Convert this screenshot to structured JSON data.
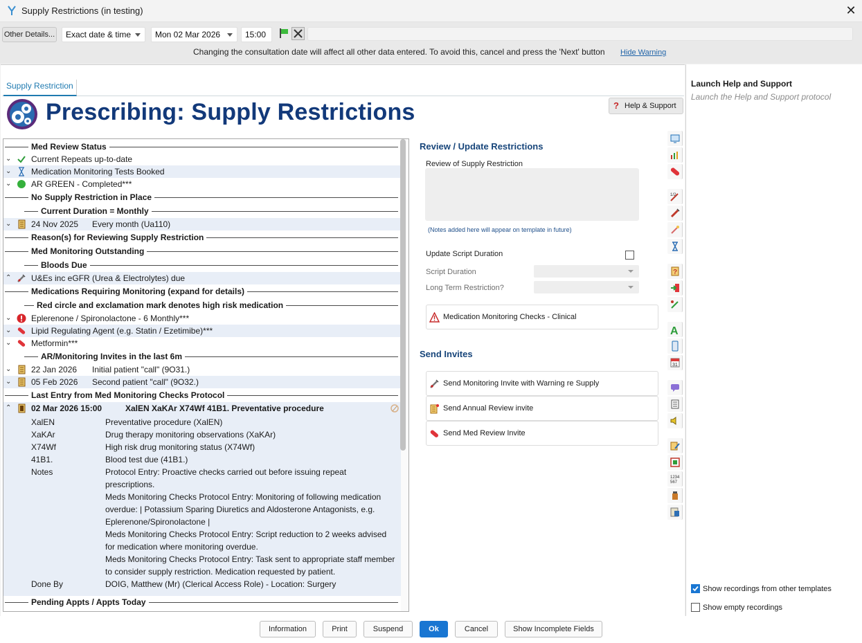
{
  "window": {
    "title": "Supply Restrictions (in testing)",
    "close": "✕"
  },
  "toolbar": {
    "other_details": "Other Details...",
    "date_mode": "Exact date & time",
    "date": "Mon 02 Mar 2026",
    "time": "15:00",
    "warning": "Changing the consultation date will affect all other data entered. To avoid this, cancel and press the 'Next' button",
    "hide_warning": "Hide Warning"
  },
  "tabs": [
    {
      "label": "Supply Restriction"
    }
  ],
  "help_button": "Help & Support",
  "page_title": "Prescribing: Supply Restrictions",
  "list": {
    "h_med_review": "Med Review Status",
    "current_repeats": "Current Repeats up-to-date",
    "monitoring_booked": "Medication Monitoring Tests Booked",
    "ar_green": "AR GREEN - Completed***",
    "h_no_supply": "No Supply Restriction in Place",
    "h_current_duration": "Current Duration = Monthly",
    "dur_date": "24 Nov 2025",
    "dur_text": "Every month (Ua110)",
    "h_reasons": "Reason(s) for Reviewing Supply Restriction",
    "h_outstanding": "Med Monitoring Outstanding",
    "h_bloods": "Bloods Due",
    "ues": "U&Es inc eGFR (Urea & Electrolytes) due",
    "h_meds_req": "Medications Requiring Monitoring (expand for details)",
    "h_red_circle": "Red circle and exclamation mark denotes high risk medication",
    "eplerenone": "Eplerenone / Spironolactone - 6 Monthly***",
    "lipid": "Lipid Regulating Agent (e.g. Statin / Ezetimibe)***",
    "metformin": "Metformin***",
    "h_invites": "AR/Monitoring Invites in the last 6m",
    "inv1_date": "22 Jan 2026",
    "inv1_text": "Initial patient \"call\" (9O31.)",
    "inv2_date": "05 Feb 2026",
    "inv2_text": "Second patient \"call\" (9O32.)",
    "h_last_entry": "Last Entry from Med Monitoring Checks Protocol",
    "entry_date": "02 Mar 2026 15:00",
    "entry_title": "XalEN XaKAr X74Wf 41B1. Preventative procedure",
    "codes": [
      {
        "code": "XalEN",
        "desc": "Preventative procedure (XalEN)"
      },
      {
        "code": "XaKAr",
        "desc": "Drug therapy monitoring observations (XaKAr)"
      },
      {
        "code": "X74Wf",
        "desc": "High risk drug monitoring status (X74Wf)"
      },
      {
        "code": "41B1.",
        "desc": "Blood test due (41B1.)"
      }
    ],
    "notes_label": "Notes",
    "notes_lines": [
      "Protocol Entry: Proactive checks carried out before issuing repeat",
      "prescriptions.",
      "Meds Monitoring Checks Protocol Entry: Monitoring of following medication",
      "overdue:  | Potassium Sparing Diuretics and Aldosterone Antagonists, e.g.",
      "Eplerenone/Spironolactone |",
      "Meds Monitoring Checks Protocol Entry: Script reduction to 2 weeks advised",
      "for medication where monitoring overdue.",
      "Meds Monitoring Checks Protocol Entry: Task sent to appropriate staff member",
      "to consider supply restriction. Medication requested by patient."
    ],
    "done_by_label": "Done By",
    "done_by": "DOIG, Matthew (Mr) (Clerical Access Role)  - Location: Surgery",
    "h_pending": "Pending Appts / Appts Today"
  },
  "form": {
    "review_title": "Review / Update Restrictions",
    "review_label": "Review of Supply Restriction",
    "notes_hint": "(Notes added here will appear on template in future)",
    "update_duration": "Update Script Duration",
    "script_duration": "Script Duration",
    "long_term": "Long Term Restriction?",
    "monitoring_checks": "Medication Monitoring Checks - Clinical",
    "send_title": "Send Invites",
    "invite_warning": "Send Monitoring Invite with Warning re Supply",
    "invite_annual": "Send Annual Review invite",
    "invite_med": "Send Med Review Invite"
  },
  "right_panel": {
    "title": "Launch Help and Support",
    "subtitle": "Launch the Help and Support protocol",
    "show_other": "Show recordings from other templates",
    "show_empty": "Show empty recordings",
    "show_other_checked": true,
    "show_empty_checked": false
  },
  "bottom": {
    "information": "Information",
    "print": "Print",
    "suspend": "Suspend",
    "ok": "Ok",
    "cancel": "Cancel",
    "incomplete": "Show Incomplete Fields"
  },
  "colors": {
    "accent": "#1976d2",
    "title_blue": "#12397a",
    "row_alt": "#e8eef7"
  }
}
